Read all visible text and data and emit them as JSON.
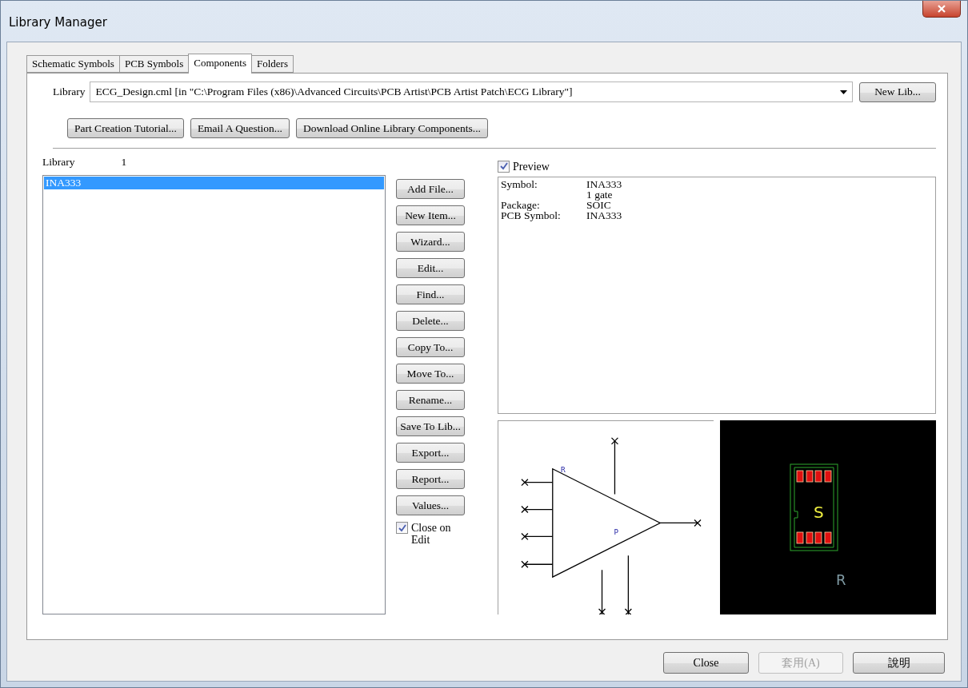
{
  "window": {
    "title": "Library Manager"
  },
  "tabs": [
    {
      "label": "Schematic Symbols",
      "selected": false
    },
    {
      "label": "PCB Symbols",
      "selected": false
    },
    {
      "label": "Components",
      "selected": true
    },
    {
      "label": "Folders",
      "selected": false
    }
  ],
  "library": {
    "label": "Library",
    "value": "ECG_Design.cml  [in \"C:\\Program Files (x86)\\Advanced Circuits\\PCB Artist\\PCB Artist Patch\\ECG Library\"]",
    "new_button": "New Lib..."
  },
  "help_buttons": [
    "Part Creation Tutorial...",
    "Email A Question...",
    "Download Online Library Components..."
  ],
  "list": {
    "label": "Library",
    "count": "1",
    "items": [
      {
        "text": "INA333",
        "selected": true
      }
    ]
  },
  "actions": [
    "Add File...",
    "New Item...",
    "Wizard...",
    "Edit...",
    "Find...",
    "Delete...",
    "Copy To...",
    "Move To...",
    "Rename...",
    "Save To Lib...",
    "Export...",
    "Report...",
    "Values..."
  ],
  "close_on_edit": {
    "label": "Close on Edit",
    "checked": true
  },
  "preview": {
    "label": "Preview",
    "checked": true,
    "rows": [
      {
        "key": "Symbol:",
        "value": "INA333"
      },
      {
        "value": "1 gate"
      },
      {
        "key": "Package:",
        "value": "SOIC"
      },
      {
        "key": "PCB Symbol:",
        "value": "INA333"
      }
    ]
  },
  "schematic": {
    "labels": [
      "R",
      "P"
    ]
  },
  "pcb": {
    "labels": [
      "S",
      "R"
    ]
  },
  "footer": [
    {
      "label": "Close",
      "disabled": false
    },
    {
      "label": "套用(A)",
      "disabled": true
    },
    {
      "label": "說明",
      "disabled": false
    }
  ]
}
